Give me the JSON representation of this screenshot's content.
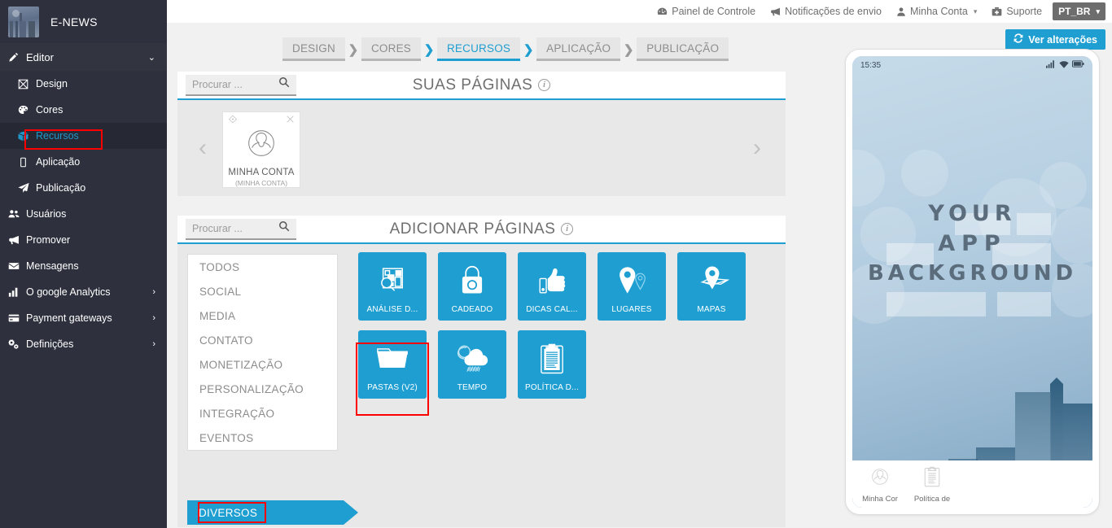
{
  "app": {
    "brand_name": "E-NEWS"
  },
  "sidebar": {
    "groups": [
      {
        "label": "Editor",
        "icon": "pencil-icon",
        "caret": "⌄",
        "children": [
          {
            "label": "Design",
            "icon": "design-icon",
            "active": false
          },
          {
            "label": "Cores",
            "icon": "palette-icon",
            "active": false
          },
          {
            "label": "Recursos",
            "icon": "box-icon",
            "active": true
          },
          {
            "label": "Aplicação",
            "icon": "mobile-icon",
            "active": false
          },
          {
            "label": "Publicação",
            "icon": "paper-plane-icon",
            "active": false
          }
        ]
      }
    ],
    "items": [
      {
        "label": "Usuários",
        "icon": "users-icon",
        "caret": ""
      },
      {
        "label": "Promover",
        "icon": "bullhorn-icon",
        "caret": ""
      },
      {
        "label": "Mensagens",
        "icon": "envelope-icon",
        "caret": ""
      },
      {
        "label": "O google Analytics",
        "icon": "bar-chart-icon",
        "caret": "›"
      },
      {
        "label": "Payment gateways",
        "icon": "credit-card-icon",
        "caret": "›"
      },
      {
        "label": "Definições",
        "icon": "gears-icon",
        "caret": "›"
      }
    ]
  },
  "topbar": {
    "items": [
      {
        "label": "Painel de Controle",
        "icon": "dashboard-icon",
        "caret": ""
      },
      {
        "label": "Notificações de envio",
        "icon": "bullhorn-icon",
        "caret": ""
      },
      {
        "label": "Minha Conta",
        "icon": "user-icon",
        "caret": "▾"
      },
      {
        "label": "Suporte",
        "icon": "medkit-icon",
        "caret": ""
      }
    ],
    "language": {
      "label": "PT_BR",
      "caret": "▾"
    }
  },
  "actions": {
    "view_changes_label": "Ver alterações",
    "view_changes_icon": "refresh-icon"
  },
  "breadcrumb": {
    "separator": "❯",
    "steps": [
      {
        "label": "DESIGN",
        "active": false
      },
      {
        "label": "CORES",
        "active": false
      },
      {
        "label": "RECURSOS",
        "active": true
      },
      {
        "label": "APLICAÇÃO",
        "active": false
      },
      {
        "label": "PUBLICAÇÃO",
        "active": false
      }
    ]
  },
  "your_pages": {
    "title": "SUAS PÁGINAS",
    "info_char": "i",
    "search_placeholder": "Procurar ...",
    "search_value": "",
    "prev_arrow": "‹",
    "next_arrow": "›",
    "cards": [
      {
        "name": "MINHA CONTA",
        "subtitle": "(MINHA CONTA)",
        "code_icon": "code-diamond-icon",
        "close_icon": "close-icon",
        "avatar_icon": "user-circle-icon"
      }
    ]
  },
  "add_pages": {
    "title": "ADICIONAR PÁGINAS",
    "info_char": "i",
    "search_placeholder": "Procurar ...",
    "search_value": "",
    "categories": [
      {
        "label": "TODOS",
        "active": false
      },
      {
        "label": "SOCIAL",
        "active": false
      },
      {
        "label": "MEDIA",
        "active": false
      },
      {
        "label": "CONTATO",
        "active": false
      },
      {
        "label": "MONETIZAÇÃO",
        "active": false
      },
      {
        "label": "PERSONALIZAÇÃO",
        "active": false
      },
      {
        "label": "INTEGRAÇÃO",
        "active": false
      },
      {
        "label": "EVENTOS",
        "active": false
      },
      {
        "label": "DIVERSOS",
        "active": true
      }
    ],
    "tiles": [
      {
        "label": "ANÁLISE D...",
        "icon": "analysis-icon",
        "highlighted": false
      },
      {
        "label": "CADEADO",
        "icon": "padlock-icon",
        "highlighted": false
      },
      {
        "label": "DICAS CAL...",
        "icon": "thumbs-up-icon",
        "highlighted": false
      },
      {
        "label": "LUGARES",
        "icon": "map-pin-icon",
        "highlighted": false
      },
      {
        "label": "MAPAS",
        "icon": "map-icon",
        "highlighted": false
      },
      {
        "label": "PASTAS (V2)",
        "icon": "folder-icon",
        "highlighted": true
      },
      {
        "label": "TEMPO",
        "icon": "weather-rain-icon",
        "highlighted": false
      },
      {
        "label": "POLÍTICA D...",
        "icon": "clipboard-icon",
        "highlighted": false
      }
    ]
  },
  "phone_preview": {
    "status_time": "15:35",
    "signal_icon": "signal-icon",
    "wifi_icon": "wifi-icon",
    "battery_icon": "battery-icon",
    "art_line1": "YOUR",
    "art_line2": "APP",
    "art_line3": "BACKGROUND",
    "nav": [
      {
        "label": "Minha Cor",
        "icon": "user-circle-icon"
      },
      {
        "label": "Política de",
        "icon": "clipboard-icon"
      }
    ]
  },
  "highlights": {
    "color": "#ff0000"
  }
}
